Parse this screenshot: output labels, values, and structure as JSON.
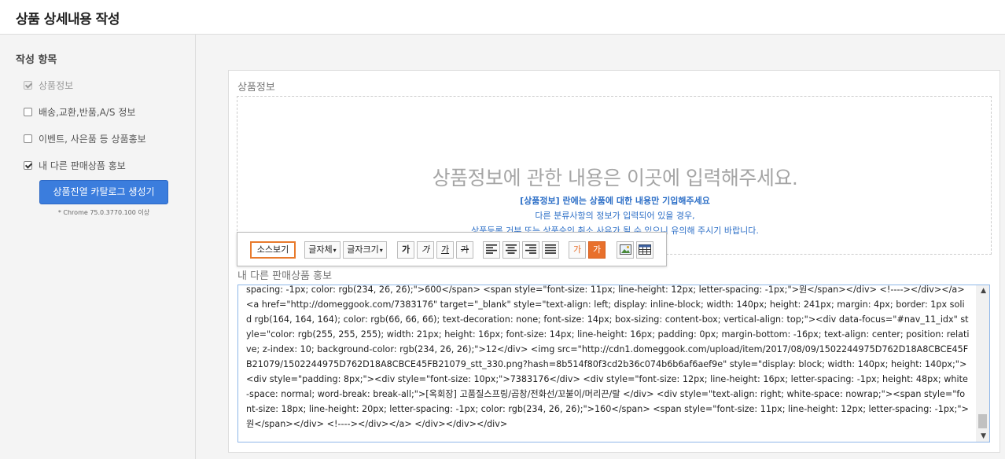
{
  "header": {
    "title": "상품 상세내용 작성"
  },
  "sidebar": {
    "section_title": "작성 항목",
    "options": [
      {
        "label": "상품정보",
        "checked": true,
        "disabled": true
      },
      {
        "label": "배송,교환,반품,A/S 정보",
        "checked": false,
        "disabled": false
      },
      {
        "label": "이벤트, 사은품 등 상품홍보",
        "checked": false,
        "disabled": false
      },
      {
        "label": "내 다른 판매상품 홍보",
        "checked": true,
        "disabled": false
      }
    ],
    "catalog_button": "상품진열 카탈로그 생성기",
    "chrome_note": "* Chrome 75.0.3770.100 이상"
  },
  "main": {
    "product_info_label": "상품정보",
    "placeholder_main": "상품정보에 관한 내용은 이곳에 입력해주세요.",
    "placeholder_sub1": "[상품정보] 란에는 상품에 대한 내용만 기입해주세요",
    "placeholder_sub2": "다른 분류사항의 정보가 입력되어 있을 경우,",
    "placeholder_sub3": "상품등록 거부 또는 상품승인 취소 사유가 될 수 있으니 유의해 주시기 바랍니다.",
    "promo_label": "내 다른 판매상품 홍보",
    "code": "spacing: -1px; color: rgb(234, 26, 26);\">600</span> <span style=\"font-size: 11px; line-height: 12px; letter-spacing: -1px;\">원</span></div> <!----></div></a> <a href=\"http://domeggook.com/7383176\" target=\"_blank\" style=\"text-align: left; display: inline-block; width: 140px; height: 241px; margin: 4px; border: 1px solid rgb(164, 164, 164); color: rgb(66, 66, 66); text-decoration: none; font-size: 14px; box-sizing: content-box; vertical-align: top;\"><div data-focus=\"#nav_11_idx\" style=\"color: rgb(255, 255, 255); width: 21px; height: 16px; font-size: 14px; line-height: 16px; padding: 0px; margin-bottom: -16px; text-align: center; position: relative; z-index: 10; background-color: rgb(234, 26, 26);\">12</div> <img src=\"http://cdn1.domeggook.com/upload/item/2017/08/09/1502244975D762D18A8CBCE45FB21079/1502244975D762D18A8CBCE45FB21079_stt_330.png?hash=8b514f80f3cd2b36c074b6b6af6aef9e\" style=\"display: block; width: 140px; height: 140px;\"> <div style=\"padding: 8px;\"><div style=\"font-size: 10px;\">7383176</div> <div style=\"font-size: 12px; line-height: 16px; letter-spacing: -1px; height: 48px; white-space: normal; word-break: break-all;\">[옥회장] 고품질스프링/곱창/전화선/꼬불이/머리끈/랄 </div> <div style=\"text-align: right; white-space: nowrap;\"><span style=\"font-size: 18px; line-height: 20px; letter-spacing: -1px; color: rgb(234, 26, 26);\">160</span> <span style=\"font-size: 11px; line-height: 12px; letter-spacing: -1px;\">원</span></div> <!----></div></a> </div></div></div>"
  },
  "toolbar": {
    "source": "소스보기",
    "font": "글자체",
    "font_size": "글자크기",
    "bold": "가",
    "italic": "가",
    "underline": "가",
    "strike": "가",
    "font_color": "가",
    "bg_color": "가"
  },
  "colors": {
    "accent": "#3b7ddd",
    "orange": "#e8702c",
    "link_blue": "#2d6fc7"
  },
  "icons": [
    "align-left-icon",
    "align-center-icon",
    "align-right-icon",
    "align-justify-icon",
    "image-icon",
    "table-icon",
    "scroll-up-icon",
    "scroll-down-icon"
  ]
}
